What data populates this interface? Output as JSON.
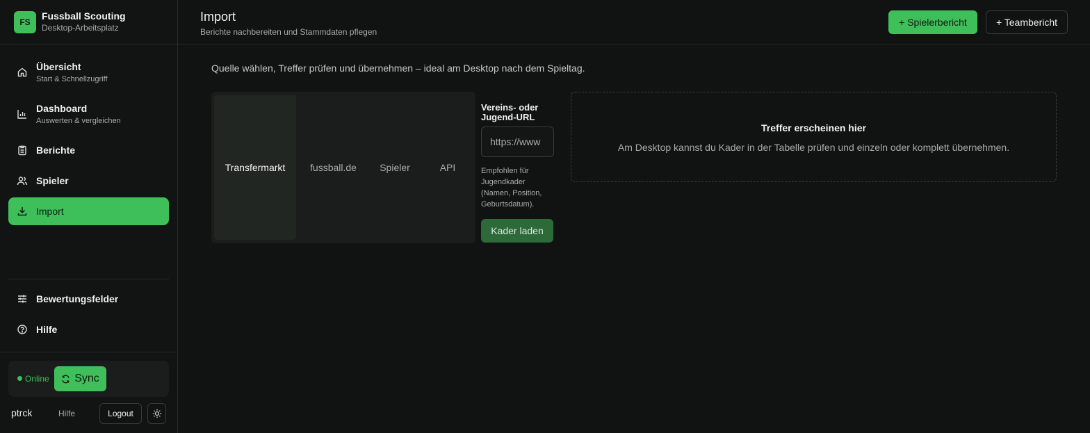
{
  "brand": {
    "initials": "FS",
    "title": "Fussball Scouting",
    "subtitle": "Desktop-Arbeitsplatz"
  },
  "nav": {
    "items": [
      {
        "label": "Übersicht",
        "sub": "Start & Schnellzugriff",
        "icon": "home-icon"
      },
      {
        "label": "Dashboard",
        "sub": "Auswerten & vergleichen",
        "icon": "bar-chart-icon"
      },
      {
        "label": "Berichte",
        "sub": "",
        "icon": "clipboard-icon"
      },
      {
        "label": "Spieler",
        "sub": "",
        "icon": "users-icon"
      },
      {
        "label": "Import",
        "sub": "",
        "icon": "download-icon",
        "active": true
      }
    ],
    "secondary": [
      {
        "label": "Bewertungsfelder",
        "icon": "sliders-icon"
      },
      {
        "label": "Hilfe",
        "icon": "help-circle-icon"
      }
    ]
  },
  "status": {
    "text": "Online",
    "sync_label": "Sync"
  },
  "user": {
    "name": "ptrck",
    "help": "Hilfe",
    "logout": "Logout"
  },
  "header": {
    "title": "Import",
    "subtitle": "Berichte nachbereiten und Stammdaten pflegen",
    "primary_button": "+ Spielerbericht",
    "secondary_button": "+ Teambericht"
  },
  "import": {
    "intro": "Quelle wählen, Treffer prüfen und übernehmen – ideal am Desktop nach dem Spieltag.",
    "sources": [
      "Transfermarkt",
      "fussball.de",
      "Spieler",
      "API"
    ],
    "active_source": "Transfermarkt",
    "field_label": "Vereins- oder Jugend-URL",
    "url_placeholder": "https://www",
    "hint": "Empfohlen für Jugendkader (Namen, Position, Geburtsdatum).",
    "load_button": "Kader laden"
  },
  "results": {
    "title": "Treffer erscheinen hier",
    "subtitle": "Am Desktop kannst du Kader in der Tabelle prüfen und einzeln oder komplett übernehmen."
  },
  "colors": {
    "accent": "#3fbf5a",
    "background": "#111312",
    "panel": "#1a1d1b"
  }
}
